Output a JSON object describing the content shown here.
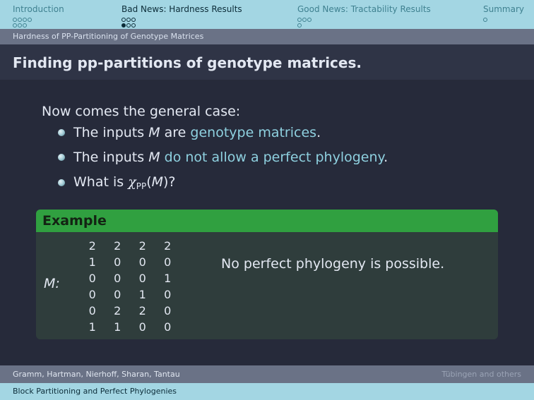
{
  "nav": {
    "sections": [
      {
        "label": "Introduction",
        "active": false
      },
      {
        "label": "Bad News: Hardness Results",
        "active": true
      },
      {
        "label": "Good News: Tractability Results",
        "active": false
      },
      {
        "label": "Summary",
        "active": false
      }
    ]
  },
  "subsection": "Hardness of PP-Partitioning of Genotype Matrices",
  "frame_title": "Finding pp-partitions of genotype matrices.",
  "intro": "Now comes the general case:",
  "bullets": {
    "b1": {
      "pre": "The inputs ",
      "var": "M",
      "mid": " are ",
      "highlight": "genotype matrices",
      "post": "."
    },
    "b2": {
      "pre": "The inputs ",
      "var": "M",
      "mid": " ",
      "highlight": "do not allow a perfect phylogeny",
      "post": "."
    },
    "b3": {
      "pre": "What is ",
      "chi": "χ",
      "sub": "PP",
      "open": "(",
      "var": "M",
      "close": ")?"
    }
  },
  "example": {
    "title": "Example",
    "matrix_label": "M:",
    "matrix": [
      [
        "2",
        "2",
        "2",
        "2"
      ],
      [
        "1",
        "0",
        "0",
        "0"
      ],
      [
        "0",
        "0",
        "0",
        "1"
      ],
      [
        "0",
        "0",
        "1",
        "0"
      ],
      [
        "0",
        "2",
        "2",
        "0"
      ],
      [
        "1",
        "1",
        "0",
        "0"
      ]
    ],
    "note": "No perfect phylogeny is possible."
  },
  "footer": {
    "authors": "Gramm, Hartman, Nierhoff, Sharan, Tantau",
    "institute": "Tübingen and others",
    "talk_title": "Block Partitioning and Perfect Phylogenies"
  },
  "colors": {
    "nav_bg": "#a3d6e3",
    "slide_bg": "#262a3a",
    "highlight": "#8ed0df",
    "example_header": "#30a040"
  }
}
